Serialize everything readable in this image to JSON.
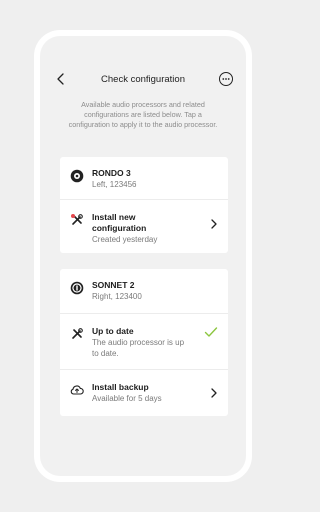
{
  "header": {
    "title": "Check configuration"
  },
  "intro": "Available audio processors and related configurations are listed below. Tap a configuration to apply it to the audio processor.",
  "cards": [
    {
      "device": {
        "name": "RONDO 3",
        "detail": "Left, 123456"
      },
      "action": {
        "title_line1": "Install new",
        "title_line2": "configuration",
        "subtitle": "Created yesterday"
      }
    },
    {
      "device": {
        "name": "SONNET 2",
        "detail": "Right, 123400"
      },
      "status": {
        "title": "Up to date",
        "subtitle_line1": "The audio processor is up",
        "subtitle_line2": "to date."
      },
      "backup": {
        "title": "Install backup",
        "subtitle": "Available for 5 days"
      }
    }
  ],
  "colors": {
    "check": "#8cc63f",
    "alert_dot": "#e5484d"
  },
  "icons": [
    "back-arrow-icon",
    "more-options-icon",
    "processor-icon",
    "tools-icon",
    "cloud-upload-icon",
    "chevron-right-icon",
    "checkmark-icon"
  ]
}
